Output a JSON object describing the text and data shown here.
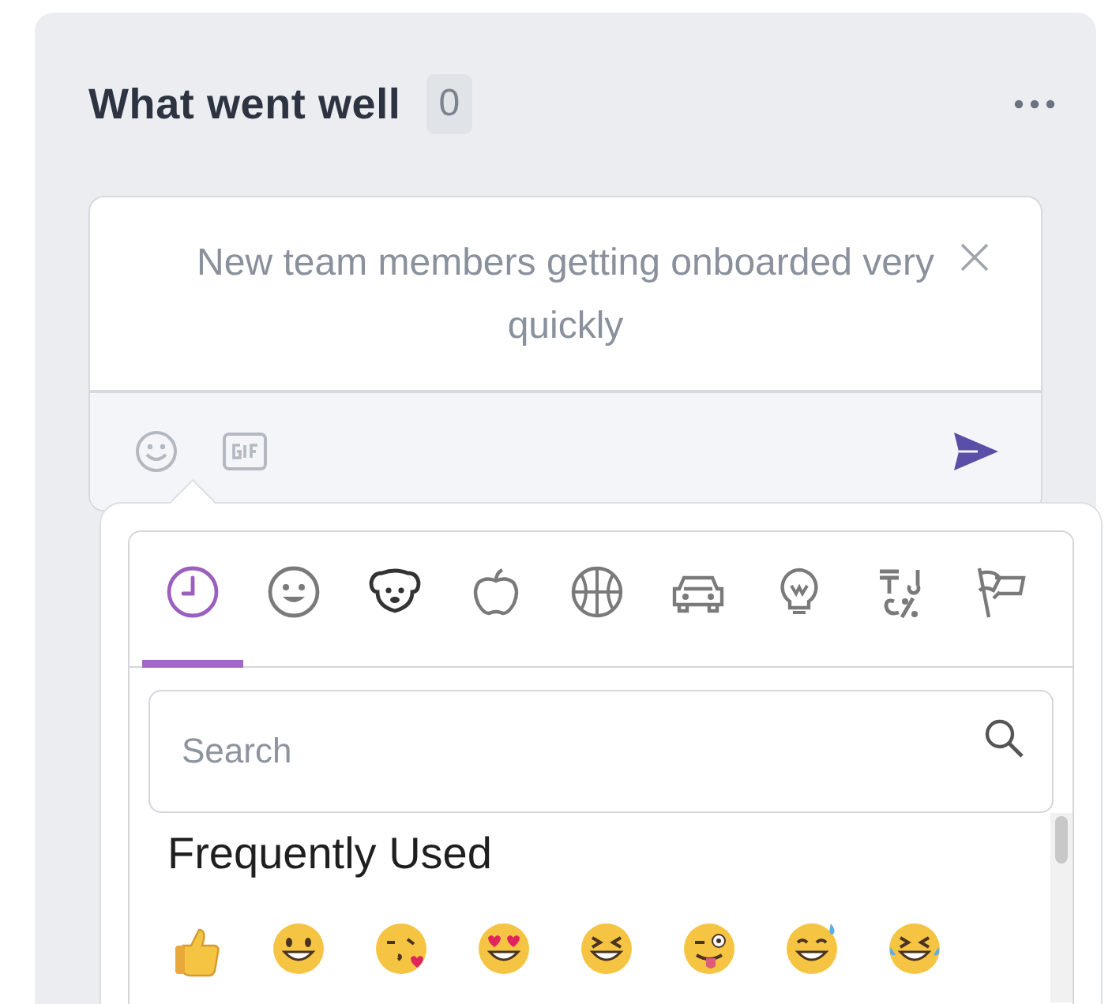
{
  "column": {
    "title": "What went well",
    "count": "0"
  },
  "card": {
    "value": "New team members getting onboarded very quickly"
  },
  "emoji_picker": {
    "categories": [
      {
        "kind": "recent",
        "selected": true
      },
      {
        "kind": "smileys",
        "selected": false
      },
      {
        "kind": "animals",
        "selected": false
      },
      {
        "kind": "food",
        "selected": false
      },
      {
        "kind": "activity",
        "selected": false
      },
      {
        "kind": "travel",
        "selected": false
      },
      {
        "kind": "objects",
        "selected": false
      },
      {
        "kind": "symbols",
        "selected": false
      },
      {
        "kind": "flags",
        "selected": false
      }
    ],
    "search": {
      "placeholder": "Search"
    },
    "section_title": "Frequently Used",
    "emojis": [
      {
        "kind": "thumbs_up"
      },
      {
        "kind": "grin"
      },
      {
        "kind": "kiss"
      },
      {
        "kind": "heart_eyes"
      },
      {
        "kind": "squint"
      },
      {
        "kind": "wink_tongue"
      },
      {
        "kind": "sweat"
      },
      {
        "kind": "tears"
      }
    ]
  }
}
